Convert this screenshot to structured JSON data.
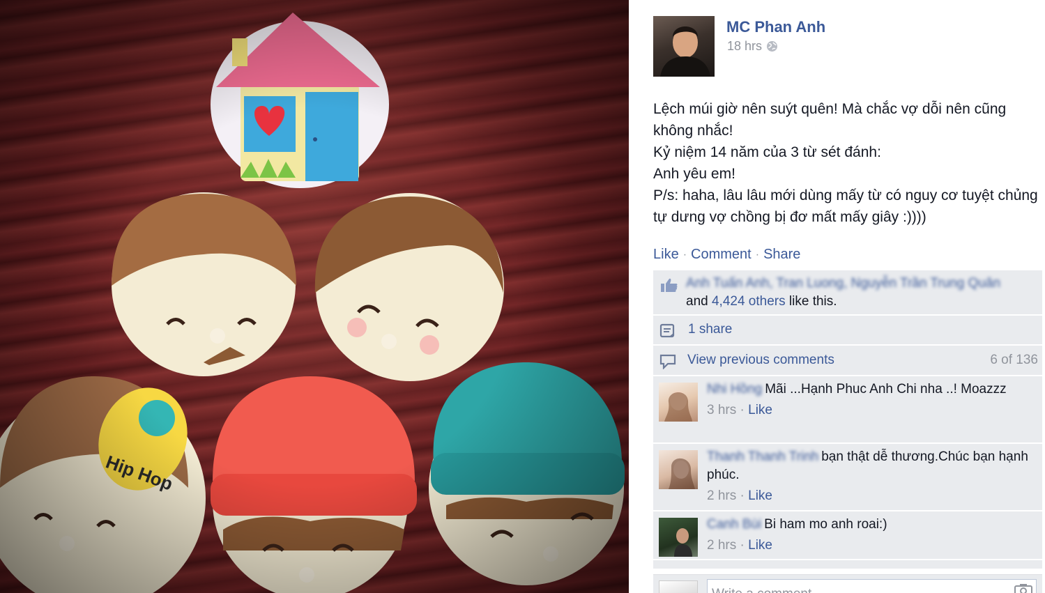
{
  "post": {
    "author": "MC Phan Anh",
    "time": "18 hrs",
    "privacy_icon": "globe-icon",
    "lines": [
      "Lệch múi giờ nên suýt quên! Mà chắc vợ dỗi nên cũng không nhắc!",
      "Kỷ niệm 14 năm của 3 từ sét đánh:",
      "Anh yêu em!",
      "P/s: haha, lâu lâu mới dùng mấy từ có nguy cơ tuyệt chủng tự dưng vợ chồng bị đơ mất mấy giây :))))"
    ]
  },
  "actions": {
    "like": "Like",
    "comment": "Comment",
    "share": "Share",
    "separator": "·"
  },
  "likes": {
    "names_blurred": "Anh Tuấn Anh, Tran Luong, Nguyễn Trần Trung Quân",
    "and": "and",
    "others_link": "4,424 others",
    "suffix": "like this."
  },
  "shares": {
    "label": "1 share"
  },
  "previous_comments": {
    "label": "View previous comments",
    "count": "6 of 136"
  },
  "comments": [
    {
      "name_blurred": "Nhi Hồng",
      "text": "Mãi ...Hạnh Phuc Anh Chi nha ..! Moazzz",
      "time": "3 hrs",
      "like": "Like"
    },
    {
      "name_blurred": "Thanh Thanh Trinh",
      "text": "bạn thật dễ thương.Chúc bạn hạnh phúc.",
      "time": "2 hrs",
      "like": "Like"
    },
    {
      "name_blurred": "Canh Bùi",
      "text": "Bi ham mo anh roai:)",
      "time": "2 hrs",
      "like": "Like"
    }
  ],
  "composer": {
    "placeholder": "Write a comment...",
    "camera_icon": "camera-icon"
  },
  "colors": {
    "link": "#3b5998",
    "meta": "#90949c",
    "ufi_bg": "#e9ebee",
    "text": "#141823"
  }
}
